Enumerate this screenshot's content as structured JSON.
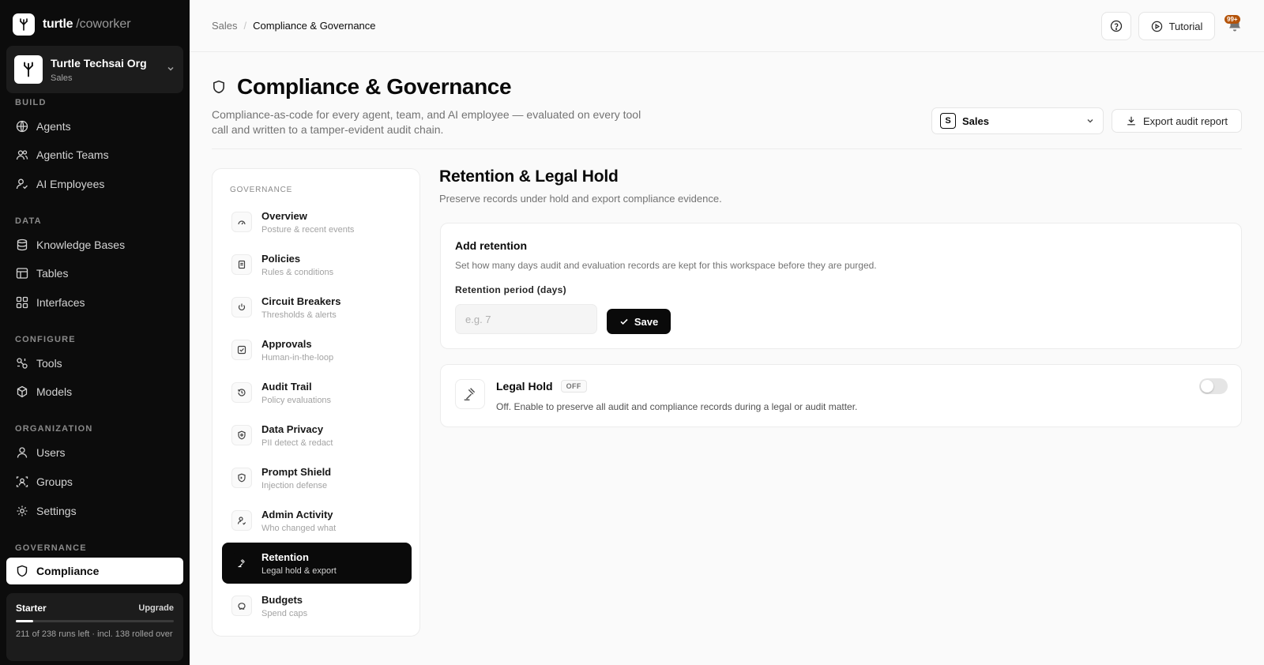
{
  "brand": {
    "name": "turtle",
    "suffix": "/coworker"
  },
  "org": {
    "name": "Turtle Techsai Org",
    "workspace": "Sales"
  },
  "sidebar": {
    "sections": [
      {
        "title": "BUILD",
        "items": [
          {
            "label": "Agents",
            "icon": "globe-icon"
          },
          {
            "label": "Agentic Teams",
            "icon": "users-icon"
          },
          {
            "label": "AI Employees",
            "icon": "user-check-icon"
          }
        ]
      },
      {
        "title": "DATA",
        "items": [
          {
            "label": "Knowledge Bases",
            "icon": "database-icon"
          },
          {
            "label": "Tables",
            "icon": "table-icon"
          },
          {
            "label": "Interfaces",
            "icon": "layout-icon"
          }
        ]
      },
      {
        "title": "CONFIGURE",
        "items": [
          {
            "label": "Tools",
            "icon": "tools-icon"
          },
          {
            "label": "Models",
            "icon": "model-icon"
          }
        ]
      },
      {
        "title": "ORGANIZATION",
        "items": [
          {
            "label": "Users",
            "icon": "user-icon"
          },
          {
            "label": "Groups",
            "icon": "group-icon"
          },
          {
            "label": "Settings",
            "icon": "gear-icon"
          }
        ]
      },
      {
        "title": "GOVERNANCE",
        "items": [
          {
            "label": "Compliance",
            "icon": "shield-icon",
            "active": true
          }
        ]
      }
    ]
  },
  "plan": {
    "name": "Starter",
    "upgrade_label": "Upgrade",
    "usage_text": "211 of 238 runs left · incl. 138 rolled over",
    "progress_fraction": 0.11
  },
  "topbar": {
    "breadcrumb_parent": "Sales",
    "breadcrumb_separator": "/",
    "breadcrumb_current": "Compliance & Governance",
    "tutorial_label": "Tutorial",
    "notification_badge": "99+"
  },
  "page": {
    "title": "Compliance & Governance",
    "description": "Compliance-as-code for every agent, team, and AI employee — evaluated on every tool call and written to a tamper-evident audit chain.",
    "workspace_badge": "S",
    "workspace_select": "Sales",
    "export_label": "Export audit report"
  },
  "governance_nav": {
    "title": "GOVERNANCE",
    "items": [
      {
        "label": "Overview",
        "sub": "Posture & recent events",
        "icon": "gauge-icon"
      },
      {
        "label": "Policies",
        "sub": "Rules & conditions",
        "icon": "document-icon"
      },
      {
        "label": "Circuit Breakers",
        "sub": "Thresholds & alerts",
        "icon": "power-icon"
      },
      {
        "label": "Approvals",
        "sub": "Human-in-the-loop",
        "icon": "checkbox-icon"
      },
      {
        "label": "Audit Trail",
        "sub": "Policy evaluations",
        "icon": "history-icon"
      },
      {
        "label": "Data Privacy",
        "sub": "PII detect & redact",
        "icon": "privacy-shield-icon"
      },
      {
        "label": "Prompt Shield",
        "sub": "Injection defense",
        "icon": "prompt-shield-icon"
      },
      {
        "label": "Admin Activity",
        "sub": "Who changed what",
        "icon": "user-activity-icon"
      },
      {
        "label": "Retention",
        "sub": "Legal hold & export",
        "icon": "gavel-icon",
        "active": true
      },
      {
        "label": "Budgets",
        "sub": "Spend caps",
        "icon": "piggy-bank-icon"
      }
    ]
  },
  "retention": {
    "title": "Retention & Legal Hold",
    "description": "Preserve records under hold and export compliance evidence.",
    "add_title": "Add retention",
    "add_description": "Set how many days audit and evaluation records are kept for this workspace before they are purged.",
    "period_label": "Retention period (days)",
    "period_placeholder": "e.g. 7",
    "period_value": "",
    "save_label": "Save"
  },
  "legal_hold": {
    "title": "Legal Hold",
    "status": "OFF",
    "description": "Off. Enable to preserve all audit and compliance records during a legal or audit matter.",
    "enabled": false
  }
}
